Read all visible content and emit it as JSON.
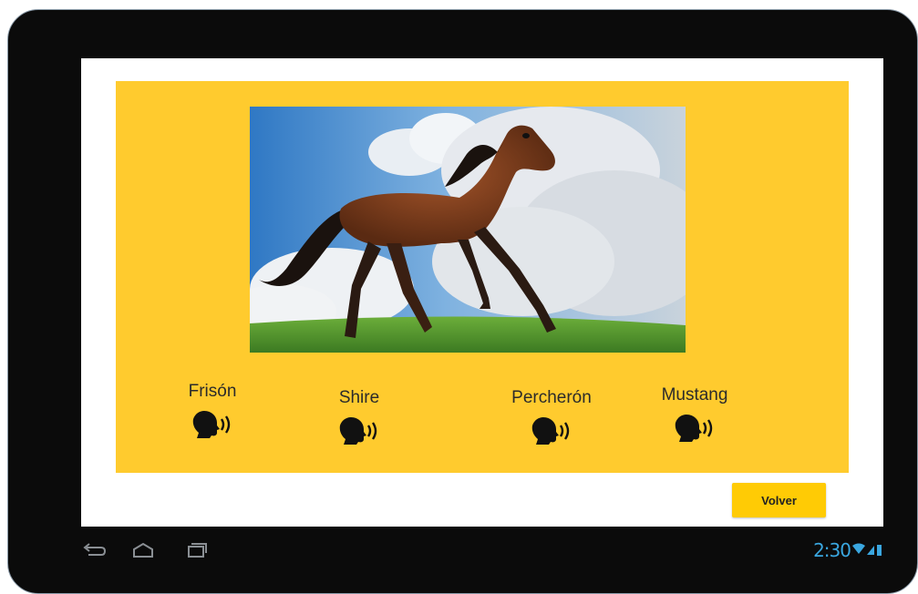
{
  "horses": [
    {
      "name": "Frisón",
      "icon": "speaker-icon"
    },
    {
      "name": "Shire",
      "icon": "speaker-icon"
    },
    {
      "name": "Percherón",
      "icon": "speaker-icon"
    },
    {
      "name": "Mustang",
      "icon": "speaker-icon"
    }
  ],
  "back_button": {
    "label": "Volver"
  },
  "status_bar": {
    "time": "2:30"
  },
  "colors": {
    "panel": "#ffcb2e",
    "button": "#ffcb05",
    "accent": "#3aa7e0",
    "frame": "#0b0b0b"
  }
}
